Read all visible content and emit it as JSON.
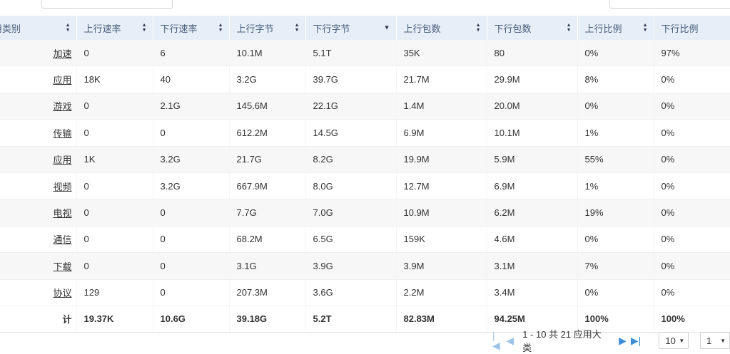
{
  "columns": [
    {
      "key": "category",
      "label": "用类别",
      "sort": "both"
    },
    {
      "key": "up_rate",
      "label": "上行速率",
      "sort": "both"
    },
    {
      "key": "down_rate",
      "label": "下行速率",
      "sort": "both"
    },
    {
      "key": "up_bytes",
      "label": "上行字节",
      "sort": "both"
    },
    {
      "key": "down_bytes",
      "label": "下行字节",
      "sort": "desc"
    },
    {
      "key": "up_pkts",
      "label": "上行包数",
      "sort": "both"
    },
    {
      "key": "down_pkts",
      "label": "下行包数",
      "sort": "both"
    },
    {
      "key": "up_ratio",
      "label": "上行比例",
      "sort": "both"
    },
    {
      "key": "down_ratio",
      "label": "下行比例",
      "sort": "none"
    }
  ],
  "rows": [
    [
      "加速",
      "0",
      "6",
      "10.1M",
      "5.1T",
      "35K",
      "80",
      "0%",
      "97%"
    ],
    [
      "应用",
      "18K",
      "40",
      "3.2G",
      "39.7G",
      "21.7M",
      "29.9M",
      "8%",
      "0%"
    ],
    [
      "游戏",
      "0",
      "2.1G",
      "145.6M",
      "22.1G",
      "1.4M",
      "20.0M",
      "0%",
      "0%"
    ],
    [
      "传输",
      "0",
      "0",
      "612.2M",
      "14.5G",
      "6.9M",
      "10.1M",
      "1%",
      "0%"
    ],
    [
      "应用",
      "1K",
      "3.2G",
      "21.7G",
      "8.2G",
      "19.9M",
      "5.9M",
      "55%",
      "0%"
    ],
    [
      "视频",
      "0",
      "3.2G",
      "667.9M",
      "8.0G",
      "12.7M",
      "6.9M",
      "1%",
      "0%"
    ],
    [
      "电视",
      "0",
      "0",
      "7.7G",
      "7.0G",
      "10.9M",
      "6.2M",
      "19%",
      "0%"
    ],
    [
      "通信",
      "0",
      "0",
      "68.2M",
      "6.5G",
      "159K",
      "4.6M",
      "0%",
      "0%"
    ],
    [
      "下载",
      "0",
      "0",
      "3.1G",
      "3.9G",
      "3.9M",
      "3.1M",
      "7%",
      "0%"
    ],
    [
      "协议",
      "129",
      "0",
      "207.3M",
      "3.6G",
      "2.2M",
      "3.4M",
      "0%",
      "0%"
    ]
  ],
  "total": [
    "计",
    "19.37K",
    "10.6G",
    "39.18G",
    "5.2T",
    "82.83M",
    "94.25M",
    "100%",
    "100%"
  ],
  "pager": {
    "summary": "1 - 10 共 21 应用大类",
    "page_size": "10",
    "page": "1"
  },
  "colors": {
    "header_bg": "#e6eef8",
    "accent": "#3a8fd8"
  }
}
